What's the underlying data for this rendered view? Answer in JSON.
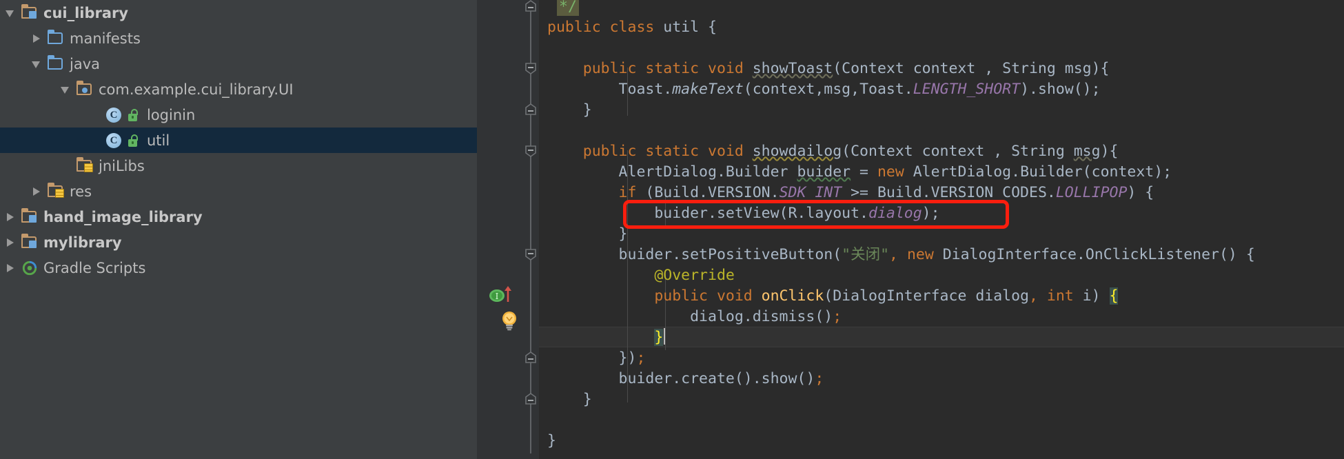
{
  "app": {
    "theme": "darcula",
    "sidebar_bg": "#3c3f41",
    "editor_bg": "#2b2b2b",
    "gutter_bg": "#313335",
    "selection_bg": "#13293d",
    "highlight_box_color": "#fa1e0e"
  },
  "project_tree": {
    "items": [
      {
        "label": "cui_library",
        "indent": 0,
        "arrow": "expanded",
        "icon": "module-folder-icon",
        "bold": true,
        "selected": false
      },
      {
        "label": "manifests",
        "indent": 1,
        "arrow": "collapsed",
        "icon": "blue-folder-icon",
        "bold": false,
        "selected": false
      },
      {
        "label": "java",
        "indent": 1,
        "arrow": "expanded",
        "icon": "blue-folder-icon",
        "bold": false,
        "selected": false
      },
      {
        "label": "com.example.cui_library.UI",
        "indent": 2,
        "arrow": "expanded",
        "icon": "package-folder-icon",
        "bold": false,
        "selected": false
      },
      {
        "label": "loginin",
        "indent": 3,
        "arrow": "none",
        "icon": "java-class-icon",
        "lock": true,
        "bold": false,
        "selected": false
      },
      {
        "label": "util",
        "indent": 3,
        "arrow": "none",
        "icon": "java-class-icon",
        "lock": true,
        "bold": false,
        "selected": true
      },
      {
        "label": "jniLibs",
        "indent": 1,
        "arrow": "none",
        "icon": "resource-folder-icon",
        "bold": false,
        "selected": false
      },
      {
        "label": "res",
        "indent": 1,
        "arrow": "collapsed",
        "icon": "resource-folder-icon",
        "bold": false,
        "selected": false
      },
      {
        "label": "hand_image_library",
        "indent": 0,
        "arrow": "collapsed",
        "icon": "module-folder-icon",
        "bold": true,
        "selected": false
      },
      {
        "label": "mylibrary",
        "indent": 0,
        "arrow": "collapsed",
        "icon": "module-folder-icon",
        "bold": true,
        "selected": false
      },
      {
        "label": "Gradle Scripts",
        "indent": 0,
        "arrow": "collapsed",
        "icon": "gradle-icon",
        "bold": false,
        "selected": false
      }
    ]
  },
  "editor": {
    "file": "util",
    "gutter_icons": [
      {
        "name": "implementing-method-icon",
        "line": 13
      },
      {
        "name": "intention-bulb-icon",
        "line": 15
      }
    ],
    "code_lines": [
      {
        "n": 1,
        "text": "*/"
      },
      {
        "n": 2,
        "text": "public class util {"
      },
      {
        "n": 3,
        "text": ""
      },
      {
        "n": 4,
        "text": "    public static void showToast(Context context , String msg){"
      },
      {
        "n": 5,
        "text": "        Toast.makeText(context,msg,Toast.LENGTH_SHORT).show();"
      },
      {
        "n": 6,
        "text": "    }"
      },
      {
        "n": 7,
        "text": ""
      },
      {
        "n": 8,
        "text": "    public static void showdailog(Context context , String msg){"
      },
      {
        "n": 9,
        "text": "        AlertDialog.Builder buider = new AlertDialog.Builder(context);"
      },
      {
        "n": 10,
        "text": "        if (Build.VERSION.SDK_INT >= Build.VERSION_CODES.LOLLIPOP) {"
      },
      {
        "n": 11,
        "text": "            buider.setView(R.layout.dialog);"
      },
      {
        "n": 12,
        "text": "        }"
      },
      {
        "n": 13,
        "text": "        buider.setPositiveButton(\"关闭\", new DialogInterface.OnClickListener() {"
      },
      {
        "n": 14,
        "text": "            @Override"
      },
      {
        "n": 15,
        "text": "            public void onClick(DialogInterface dialog, int i) {"
      },
      {
        "n": 16,
        "text": "                dialog.dismiss();"
      },
      {
        "n": 17,
        "text": "            }"
      },
      {
        "n": 18,
        "text": "        });"
      },
      {
        "n": 19,
        "text": "        buider.create().show();"
      },
      {
        "n": 20,
        "text": "    }"
      },
      {
        "n": 21,
        "text": ""
      },
      {
        "n": 22,
        "text": "}"
      }
    ],
    "highlighted_line_text": "buider.setView(R.layout.dialog);",
    "caret_line": 17,
    "tokens": {
      "comment_end": "*/",
      "l2_kw": "public class",
      "l2_name": " util {",
      "l4_kw": "    public static void ",
      "l4_meth": "showToast",
      "l4_sig": "(Context context , String msg){",
      "l5_a": "        Toast.",
      "l5_makeText": "makeText",
      "l5_b": "(context",
      "l5_c": ",msg,Toast.",
      "l5_const": "LENGTH_SHORT",
      "l5_d": ").show();",
      "l6": "    }",
      "l8_kw": "    public static void ",
      "l8_meth": "showdailog",
      "l8_sig": "(Context context , String ",
      "l8_msg": "msg",
      "l8_end": "){",
      "l9_a": "        AlertDialog.Builder ",
      "l9_var": "buider",
      "l9_eq": " = ",
      "l9_new": "new",
      "l9_rest": " AlertDialog.Builder(context);",
      "l10_if": "        if",
      "l10_a": " (Build.VERSION.",
      "l10_sdk": "SDK_INT",
      "l10_b": " >= Build.VERSION_CODES.",
      "l10_lollipop": "LOLLIPOP",
      "l10_c": ") {",
      "l11_a": "            buider.setView(R.layout.",
      "l11_dialog": "dialog",
      "l11_b": ");",
      "l12": "        }",
      "l13_a": "        buider.setPositiveButton(",
      "l13_str": "\"关闭\"",
      "l13_comma": ",",
      "l13_new": " new",
      "l13_b": " DialogInterface.OnClickListener() {",
      "l14_anno": "            @Override",
      "l15_kw": "            public void ",
      "l15_meth": "onClick",
      "l15_a": "(DialogInterface dialog",
      "l15_comma": ",",
      "l15_int": " int",
      "l15_b": " i) ",
      "l15_brace": "{",
      "l16_a": "                dialog.dismiss()",
      "l16_semi": ";",
      "l17_brace": "}",
      "l18_a": "        })",
      "l18_semi": ";",
      "l19_a": "        buider.create().show()",
      "l19_semi": ";",
      "l20": "    }",
      "l22": "}"
    }
  }
}
